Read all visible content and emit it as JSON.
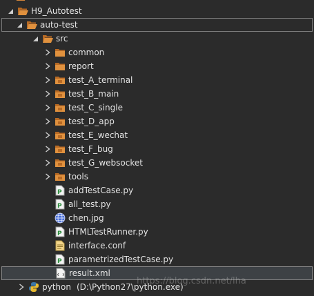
{
  "explorer": {
    "root": {
      "label": "H9_Autotest"
    },
    "project": {
      "label": "auto-test"
    },
    "src": {
      "label": "src"
    },
    "folders": [
      {
        "label": "common"
      },
      {
        "label": "report"
      },
      {
        "label": "test_A_terminal"
      },
      {
        "label": "test_B_main"
      },
      {
        "label": "test_C_single"
      },
      {
        "label": "test_D_app"
      },
      {
        "label": "test_E_wechat"
      },
      {
        "label": "test_F_bug"
      },
      {
        "label": "test_G_websocket"
      },
      {
        "label": "tools"
      }
    ],
    "files": [
      {
        "label": "addTestCase.py",
        "icon": "python-file-icon"
      },
      {
        "label": "all_test.py",
        "icon": "python-file-icon"
      },
      {
        "label": "chen.jpg",
        "icon": "globe-icon"
      },
      {
        "label": "HTMLTestRunner.py",
        "icon": "python-file-icon"
      },
      {
        "label": "interface.conf",
        "icon": "text-file-icon"
      },
      {
        "label": "parametrizedTestCase.py",
        "icon": "python-file-icon"
      },
      {
        "label": "result.xml",
        "icon": "xml-file-icon"
      }
    ],
    "interpreter": {
      "label": "python",
      "path": "(D:\\Python27\\python.exe)"
    }
  },
  "watermark": "https://blog.csdn.net/lha",
  "colors": {
    "background": "#2b2b2b",
    "folder": "#d9873a",
    "folder_dark": "#b86a24",
    "text": "#e3e3e3",
    "arrow": "#cfcfcf"
  }
}
